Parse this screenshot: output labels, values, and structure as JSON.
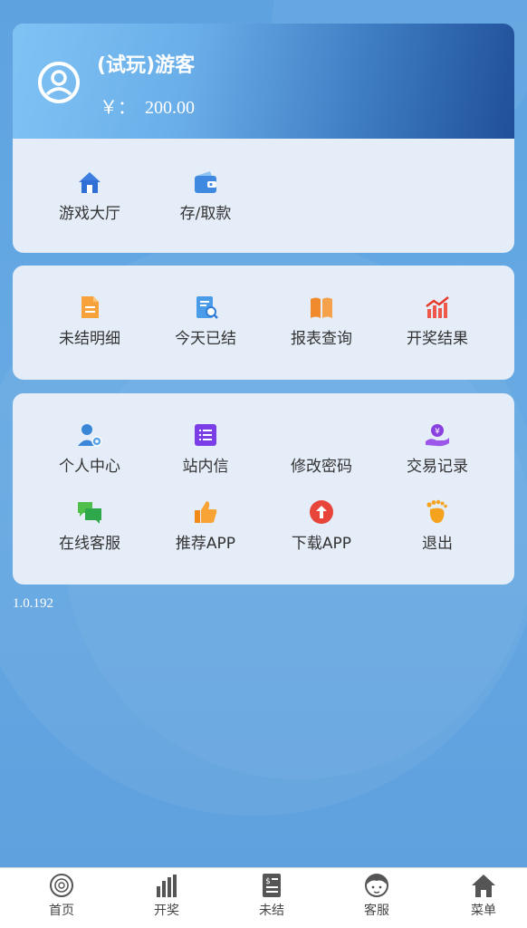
{
  "user": {
    "name": "(试玩)游客",
    "balance": "￥：  200.00",
    "avatar_icon": "user-circle-icon"
  },
  "quick_actions": [
    {
      "label": "游戏大厅",
      "icon": "house-icon"
    },
    {
      "label": "存/取款",
      "icon": "wallet-icon"
    }
  ],
  "order_menu": [
    {
      "label": "未结明细",
      "icon": "document-icon"
    },
    {
      "label": "今天已结",
      "icon": "report-search-icon"
    },
    {
      "label": "报表查询",
      "icon": "book-icon"
    },
    {
      "label": "开奖结果",
      "icon": "trend-chart-icon"
    }
  ],
  "account_menu": [
    {
      "label": "个人中心",
      "icon": "user-settings-icon"
    },
    {
      "label": "站内信",
      "icon": "message-list-icon"
    },
    {
      "label": "修改密码",
      "icon": "lock-icon"
    },
    {
      "label": "交易记录",
      "icon": "money-hand-icon"
    },
    {
      "label": "在线客服",
      "icon": "chat-bubbles-icon"
    },
    {
      "label": "推荐APP",
      "icon": "thumbs-up-icon"
    },
    {
      "label": "下载APP",
      "icon": "download-arrow-icon"
    },
    {
      "label": "退出",
      "icon": "footprint-icon"
    }
  ],
  "version": "1.0.192",
  "tabbar": [
    {
      "label": "首页",
      "icon": "home-circle-icon"
    },
    {
      "label": "开奖",
      "icon": "bar-chart-icon"
    },
    {
      "label": "未结",
      "icon": "receipt-icon"
    },
    {
      "label": "客服",
      "icon": "agent-icon"
    },
    {
      "label": "菜单",
      "icon": "home-icon"
    }
  ],
  "colors": {
    "background": "#62a6e2",
    "card": "#e4edf8",
    "header_start": "#7fc3f5",
    "header_end": "#1f4f98"
  }
}
